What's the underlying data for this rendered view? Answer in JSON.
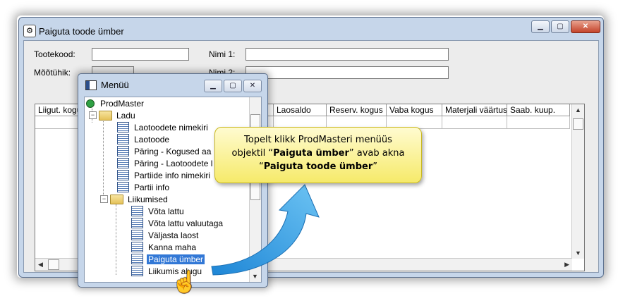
{
  "main_window": {
    "title": "Paiguta toode ümber",
    "labels": {
      "tootekood": "Tootekood:",
      "nimi1": "Nimi 1:",
      "mootuhik": "Mõõtühik:",
      "nimi2": "Nimi 2:"
    },
    "fields": {
      "tootekood": "",
      "nimi1": "",
      "mootuhik": "",
      "nimi2": ""
    },
    "grid": {
      "columns": [
        "Liigut. kogus",
        "",
        "",
        "",
        "",
        "Laosaldo",
        "Reserv. kogus",
        "Vaba kogus",
        "Materjali väärtus",
        "Saab. kuup."
      ],
      "rows": []
    }
  },
  "menu_window": {
    "title": "Menüü",
    "tree": [
      {
        "label": "ProdMaster",
        "type": "root",
        "level": 0
      },
      {
        "label": "Ladu",
        "type": "folder",
        "level": 1,
        "expanded": true
      },
      {
        "label": "Laotoodete nimekiri",
        "type": "list",
        "level": 2
      },
      {
        "label": "Laotoode",
        "type": "form",
        "level": 2
      },
      {
        "label": "Päring - Kogused aa",
        "type": "form",
        "level": 2
      },
      {
        "label": "Päring - Laotoodete l",
        "type": "form",
        "level": 2
      },
      {
        "label": "Partiide info nimekiri",
        "type": "list",
        "level": 2
      },
      {
        "label": "Partii info",
        "type": "form",
        "level": 2
      },
      {
        "label": "Liikumised",
        "type": "folder",
        "level": 2,
        "expanded": true
      },
      {
        "label": "Võta lattu",
        "type": "form",
        "level": 3
      },
      {
        "label": "Võta lattu valuutaga",
        "type": "form",
        "level": 3
      },
      {
        "label": "Väljasta laost",
        "type": "form",
        "level": 3
      },
      {
        "label": "Kanna maha",
        "type": "form",
        "level": 3
      },
      {
        "label": "Paiguta ümber",
        "type": "form",
        "level": 3,
        "selected": true
      },
      {
        "label": "Liikumis  alugu",
        "type": "list",
        "level": 3
      }
    ]
  },
  "callout": {
    "line1": "Topelt klikk ProdMasteri menüüs",
    "line2_pre": "objektil “",
    "line2_bold": "Paiguta ümber",
    "line2_post": "” avab akna",
    "line3_pre": "“",
    "line3_bold": "Paiguta toode ümber",
    "line3_post": "”"
  },
  "colors": {
    "callout_fill": "#f6ea6a",
    "arrow": "#2f9be0",
    "selection": "#3278d6"
  }
}
